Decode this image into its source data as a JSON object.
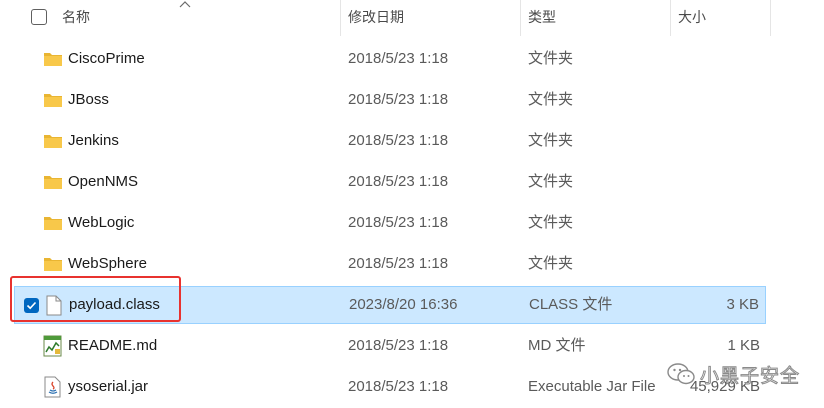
{
  "header": {
    "name": "名称",
    "date_modified": "修改日期",
    "type": "类型",
    "size": "大小"
  },
  "files": [
    {
      "name": "CiscoPrime",
      "date": "2018/5/23 1:18",
      "type": "文件夹",
      "size": "",
      "icon": "folder-icon"
    },
    {
      "name": "JBoss",
      "date": "2018/5/23 1:18",
      "type": "文件夹",
      "size": "",
      "icon": "folder-icon"
    },
    {
      "name": "Jenkins",
      "date": "2018/5/23 1:18",
      "type": "文件夹",
      "size": "",
      "icon": "folder-icon"
    },
    {
      "name": "OpenNMS",
      "date": "2018/5/23 1:18",
      "type": "文件夹",
      "size": "",
      "icon": "folder-icon"
    },
    {
      "name": "WebLogic",
      "date": "2018/5/23 1:18",
      "type": "文件夹",
      "size": "",
      "icon": "folder-icon"
    },
    {
      "name": "WebSphere",
      "date": "2018/5/23 1:18",
      "type": "文件夹",
      "size": "",
      "icon": "folder-icon"
    },
    {
      "name": "payload.class",
      "date": "2023/8/20 16:36",
      "type": "CLASS 文件",
      "size": "3 KB",
      "icon": "file-icon",
      "selected": true
    },
    {
      "name": "README.md",
      "date": "2018/5/23 1:18",
      "type": "MD 文件",
      "size": "1 KB",
      "icon": "markdown-file-icon"
    },
    {
      "name": "ysoserial.jar",
      "date": "2018/5/23 1:18",
      "type": "Executable Jar File",
      "size": "45,929 KB",
      "icon": "java-jar-icon"
    }
  ],
  "watermark": {
    "text": "小黑子安全",
    "icon": "wechat-icon"
  },
  "colors": {
    "selection_bg": "#cce8ff",
    "selection_border": "#99d1ff",
    "highlight_box": "#e8322f",
    "folder": "#f8c84a",
    "checkbox_accent": "#0067c0"
  }
}
